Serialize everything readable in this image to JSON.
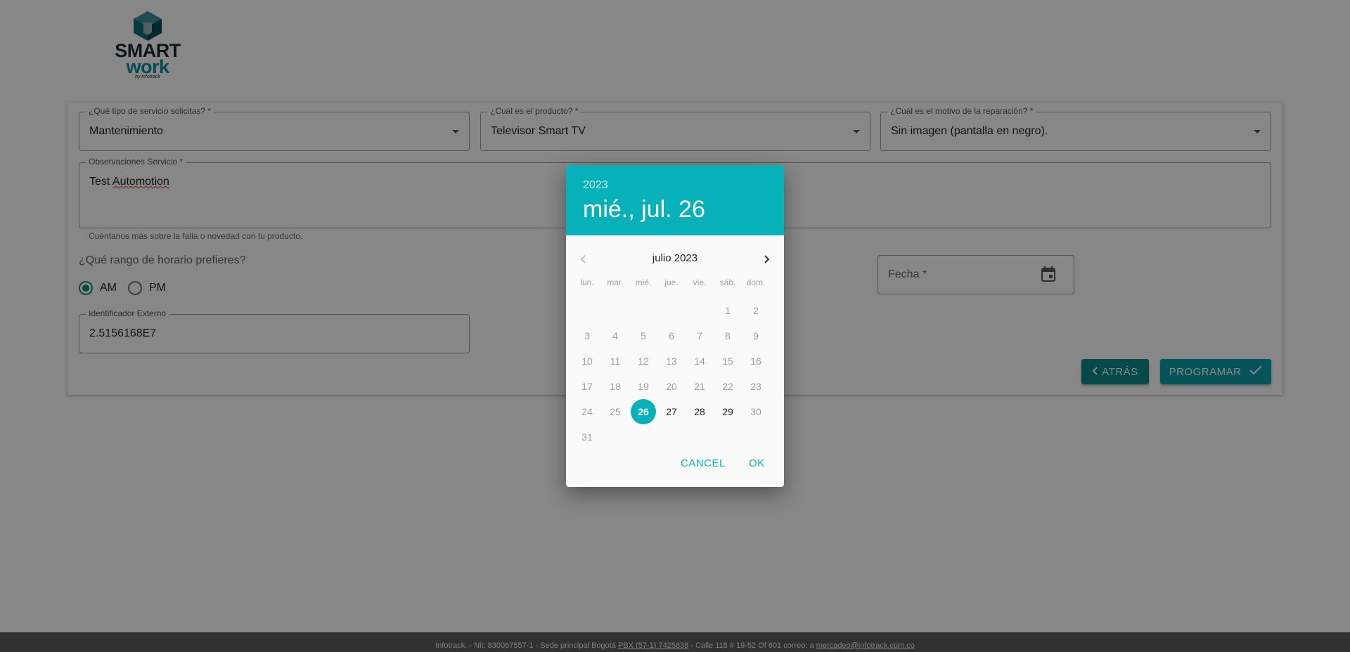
{
  "logo": {
    "word1": "SMART",
    "word2": "work",
    "by": "by infotrack"
  },
  "form": {
    "service_type": {
      "label": "¿Qué tipo de servicio solicitas? *",
      "value": "Mantenimiento"
    },
    "product": {
      "label": "¿Cuál es el producto? *",
      "value": "Televisor Smart TV"
    },
    "repair_reason": {
      "label": "¿Cuál es el motivo de la reparación? *",
      "value": "Sin imagen (pantalla en negro)."
    },
    "observations": {
      "label": "Observaciones Servicio *",
      "value_part1": "Test",
      "value_part2": "Automotion",
      "helper": "Cuéntanos más sobre la falla o novedad con tu producto."
    },
    "schedule": {
      "question": "¿Qué rango de horario prefieres?",
      "options": [
        {
          "label": "AM",
          "selected": true
        },
        {
          "label": "PM",
          "selected": false
        }
      ]
    },
    "date": {
      "label": "Fecha *"
    },
    "external_id": {
      "label": "Identificador Externo",
      "value": "2.5156168E7"
    },
    "buttons": {
      "back": "ATRÁS",
      "schedule": "PROGRAMAR"
    }
  },
  "footer": {
    "part1": "Infotrack. - Nit: 830067557-1 - Sede principal Bogotá",
    "phone": "PBX (57-1) 7425838",
    "part2": "- Calle 118 # 19-52 Of 601   correo: a",
    "email": "mercadeo@infotrack.com.co"
  },
  "datepicker": {
    "year": "2023",
    "selected_date": "mié., jul. 26",
    "month_label": "julio 2023",
    "weekdays": [
      "lun.",
      "mar.",
      "mié.",
      "jue.",
      "vie.",
      "sáb.",
      "dom."
    ],
    "first_weekday_index": 5,
    "days_in_month": 31,
    "selected_day": 26,
    "min_enabled_day": 26,
    "max_enabled_day": 29,
    "cancel_label": "CANCEL",
    "ok_label": "OK"
  },
  "colors": {
    "accent": "#06b1b9",
    "button_bg": "#0a8b8b",
    "overlay": "rgba(0,0,0,0.47)"
  },
  "icons": {
    "calendar": "calendar-icon",
    "caret": "dropdown-caret-icon",
    "check": "check-icon",
    "chevron_left": "chevron-left-icon",
    "chevron_right": "chevron-right-icon"
  }
}
